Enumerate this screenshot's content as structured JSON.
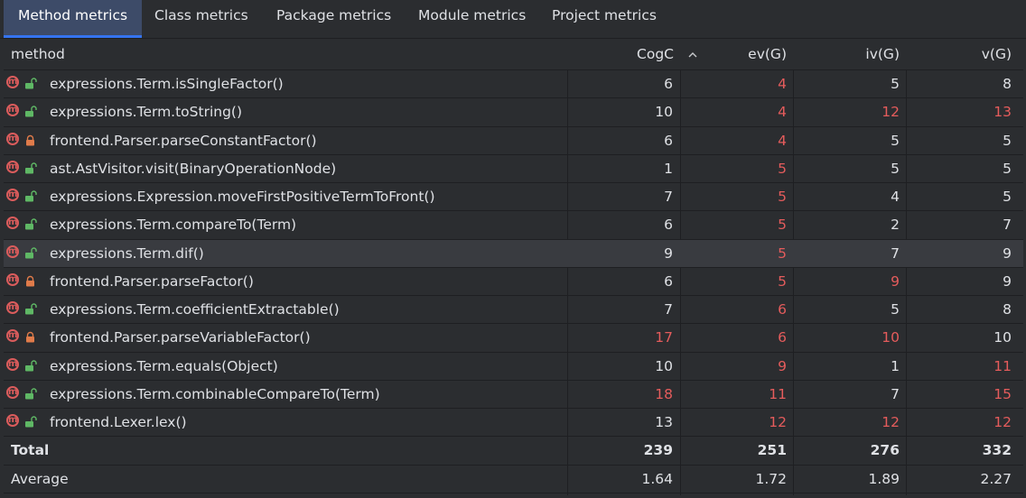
{
  "tabs": [
    {
      "label": "Method metrics",
      "active": true
    },
    {
      "label": "Class metrics",
      "active": false
    },
    {
      "label": "Package metrics",
      "active": false
    },
    {
      "label": "Module metrics",
      "active": false
    },
    {
      "label": "Project metrics",
      "active": false
    }
  ],
  "columns": {
    "method": "method",
    "cogc": "CogC",
    "evg": "ev(G)",
    "ivg": "iv(G)",
    "vg": "v(G)"
  },
  "sort_icon": "chevron-up-icon",
  "colors": {
    "warning": "#e55c5c",
    "method_icon": "#db5c5c",
    "lock_public": "#5fb865",
    "lock_private": "#e07b4a"
  },
  "rows": [
    {
      "method": "expressions.Term.isSingleFactor()",
      "access": "public",
      "cogc": "6",
      "evg": "4",
      "ivg": "5",
      "vg": "8",
      "warn": {
        "evg": true
      }
    },
    {
      "method": "expressions.Term.toString()",
      "access": "public",
      "cogc": "10",
      "evg": "4",
      "ivg": "12",
      "vg": "13",
      "warn": {
        "evg": true,
        "ivg": true,
        "vg": true
      }
    },
    {
      "method": "frontend.Parser.parseConstantFactor()",
      "access": "private",
      "cogc": "6",
      "evg": "4",
      "ivg": "5",
      "vg": "5",
      "warn": {
        "evg": true
      }
    },
    {
      "method": "ast.AstVisitor.visit(BinaryOperationNode)",
      "access": "public",
      "cogc": "1",
      "evg": "5",
      "ivg": "5",
      "vg": "5",
      "warn": {
        "evg": true
      }
    },
    {
      "method": "expressions.Expression.moveFirstPositiveTermToFront()",
      "access": "public",
      "cogc": "7",
      "evg": "5",
      "ivg": "4",
      "vg": "5",
      "warn": {
        "evg": true
      }
    },
    {
      "method": "expressions.Term.compareTo(Term)",
      "access": "public",
      "cogc": "6",
      "evg": "5",
      "ivg": "2",
      "vg": "7",
      "warn": {
        "evg": true
      }
    },
    {
      "method": "expressions.Term.dif()",
      "access": "public",
      "cogc": "9",
      "evg": "5",
      "ivg": "7",
      "vg": "9",
      "warn": {
        "evg": true
      },
      "selected": true
    },
    {
      "method": "frontend.Parser.parseFactor()",
      "access": "private",
      "cogc": "6",
      "evg": "5",
      "ivg": "9",
      "vg": "9",
      "warn": {
        "evg": true,
        "ivg": true
      }
    },
    {
      "method": "expressions.Term.coefficientExtractable()",
      "access": "public",
      "cogc": "7",
      "evg": "6",
      "ivg": "5",
      "vg": "8",
      "warn": {
        "evg": true
      }
    },
    {
      "method": "frontend.Parser.parseVariableFactor()",
      "access": "private",
      "cogc": "17",
      "evg": "6",
      "ivg": "10",
      "vg": "10",
      "warn": {
        "cogc": true,
        "evg": true,
        "ivg": true
      }
    },
    {
      "method": "expressions.Term.equals(Object)",
      "access": "public",
      "cogc": "10",
      "evg": "9",
      "ivg": "1",
      "vg": "11",
      "warn": {
        "evg": true,
        "vg": true
      }
    },
    {
      "method": "expressions.Term.combinableCompareTo(Term)",
      "access": "public",
      "cogc": "18",
      "evg": "11",
      "ivg": "7",
      "vg": "15",
      "warn": {
        "cogc": true,
        "evg": true,
        "vg": true
      }
    },
    {
      "method": "frontend.Lexer.lex()",
      "access": "public",
      "cogc": "13",
      "evg": "12",
      "ivg": "12",
      "vg": "12",
      "warn": {
        "evg": true,
        "ivg": true,
        "vg": true
      }
    }
  ],
  "summary": [
    {
      "label": "Total",
      "cogc": "239",
      "evg": "251",
      "ivg": "276",
      "vg": "332",
      "bold": true
    },
    {
      "label": "Average",
      "cogc": "1.64",
      "evg": "1.72",
      "ivg": "1.89",
      "vg": "2.27",
      "bold": false
    }
  ]
}
